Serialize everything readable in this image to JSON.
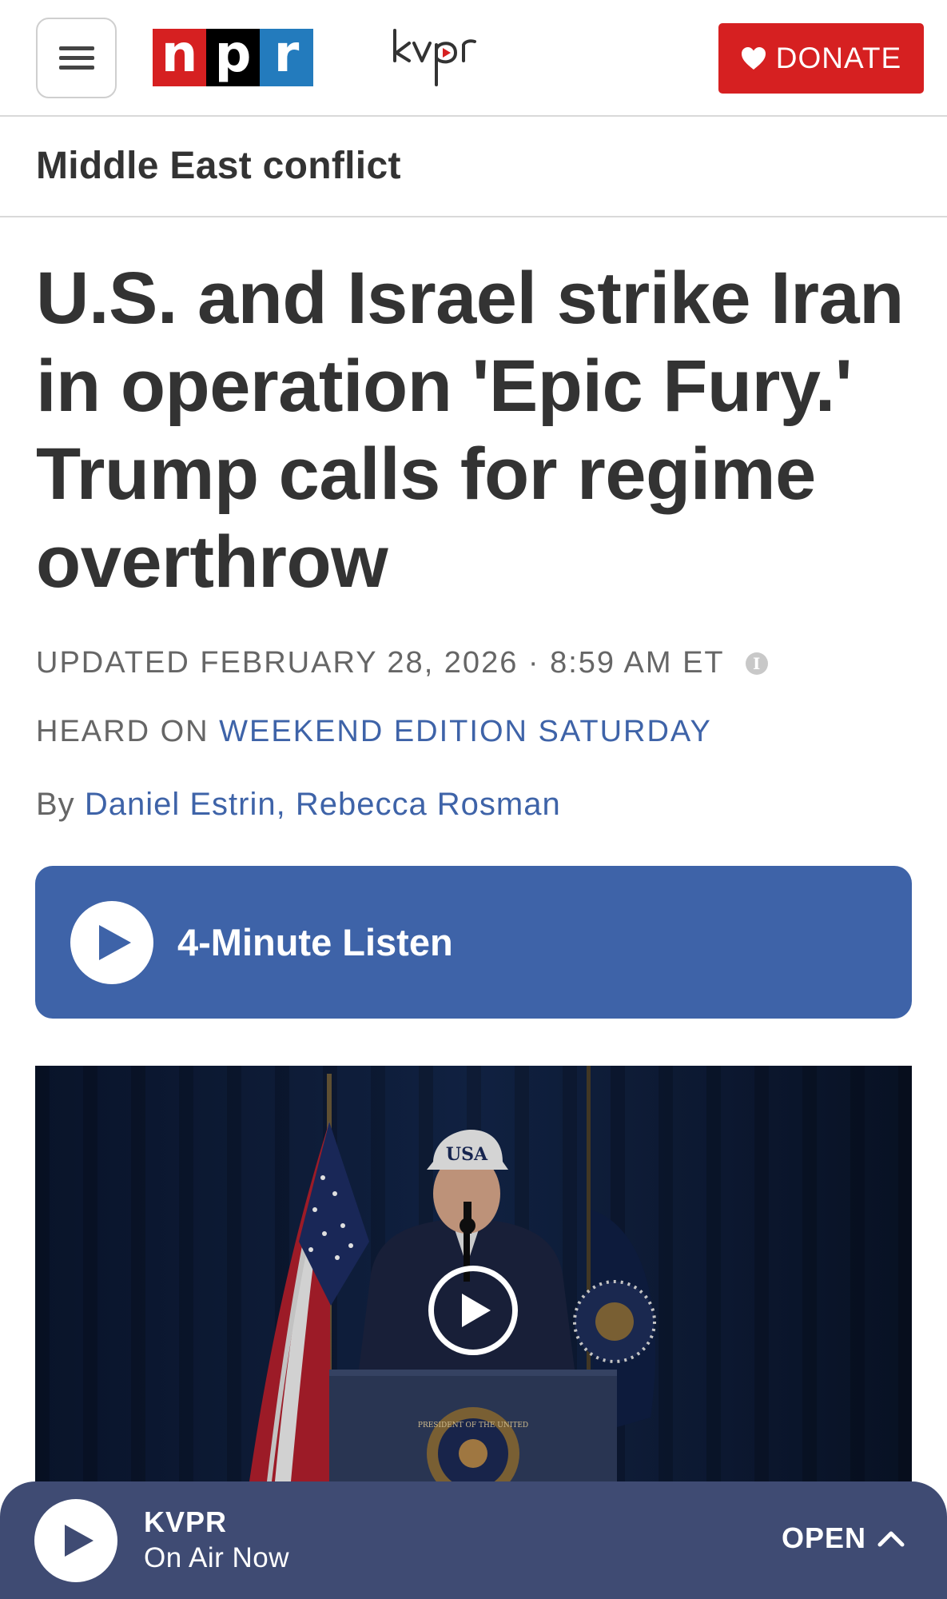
{
  "header": {
    "menu_icon": "hamburger-menu-icon",
    "npr_logo": {
      "letters": [
        "n",
        "p",
        "r"
      ],
      "colors": [
        "#d62021",
        "#000000",
        "#237bbd"
      ]
    },
    "station_logo_text": "kvpr",
    "donate_label": "DONATE",
    "donate_icon": "heart-icon",
    "donate_color": "#d62021"
  },
  "section": {
    "label": "Middle East conflict"
  },
  "article": {
    "headline": "U.S. and Israel strike Iran in operation 'Epic Fury.' Trump calls for regime overthrow",
    "updated": "UPDATED FEBRUARY 28, 2026 · 8:59 AM ET",
    "info_icon": "info-icon",
    "heard_on_prefix": "HEARD ON",
    "heard_on_program": "WEEKEND EDITION SATURDAY",
    "byline_prefix": "By",
    "authors": [
      "Daniel Estrin",
      "Rebecca Rosman"
    ],
    "author_separator": ", "
  },
  "listen": {
    "label": "4-Minute Listen",
    "icon": "play-icon",
    "color": "#3e63a8"
  },
  "media": {
    "cap_text": "USA",
    "seal_text": "PRESIDENT OF THE UNITED",
    "play_icon": "video-play-icon"
  },
  "player": {
    "station": "KVPR",
    "status": "On Air Now",
    "open_label": "OPEN",
    "open_icon": "chevron-up-icon",
    "bar_color": "#3f4b73"
  }
}
